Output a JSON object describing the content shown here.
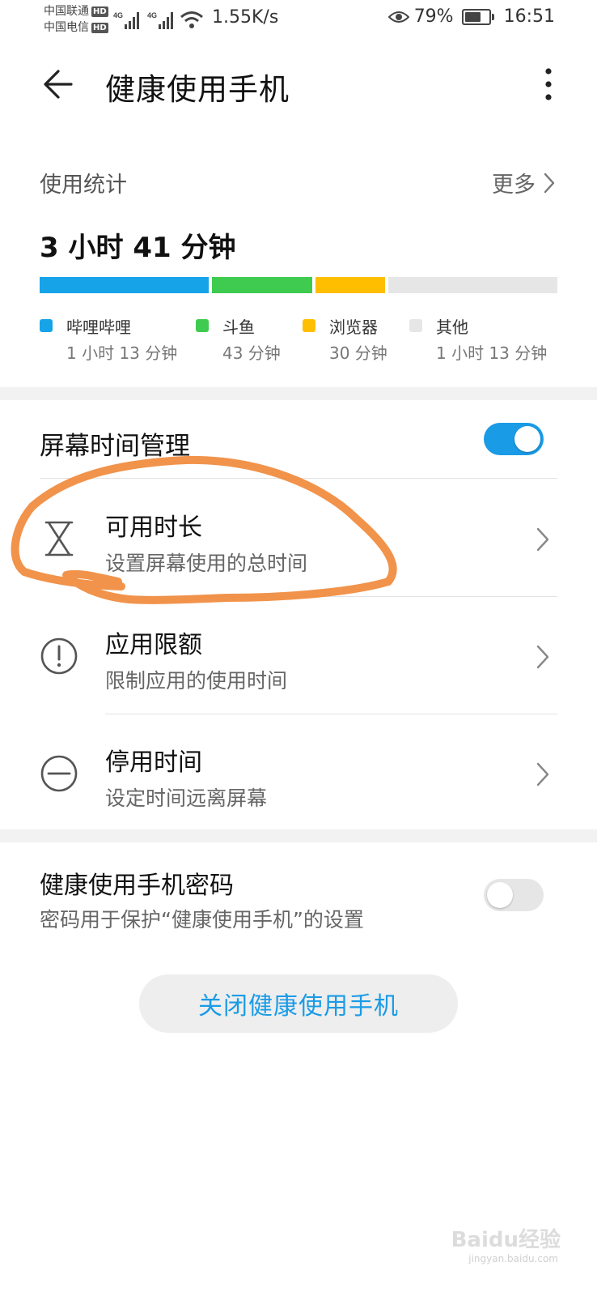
{
  "status_bar": {
    "carrier1": "中国联通",
    "carrier2": "中国电信",
    "hd": "HD",
    "net": "4G",
    "speed": "1.55K/s",
    "battery_text": "79%",
    "battery_level": 0.79,
    "time": "16:51"
  },
  "app_bar": {
    "title": "健康使用手机",
    "back_icon": "arrow-left-icon",
    "more_icon": "more-vert-icon"
  },
  "usage": {
    "label": "使用统计",
    "more": "更多",
    "total": "3 小时 41 分钟",
    "apps": [
      {
        "name": "哔哩哔哩",
        "duration": "1 小时 13 分钟",
        "color": "#16a3e8",
        "minutes": 73
      },
      {
        "name": "斗鱼",
        "duration": "43 分钟",
        "color": "#3fcb4f",
        "minutes": 43
      },
      {
        "name": "浏览器",
        "duration": "30 分钟",
        "color": "#ffbe00",
        "minutes": 30
      },
      {
        "name": "其他",
        "duration": "1 小时 13 分钟",
        "color": "#e6e6e6",
        "minutes": 73
      }
    ]
  },
  "screen_time": {
    "title": "屏幕时间管理",
    "toggle_on": true,
    "items": [
      {
        "title": "可用时长",
        "subtitle": "设置屏幕使用的总时间",
        "icon": "hourglass-icon"
      },
      {
        "title": "应用限额",
        "subtitle": "限制应用的使用时间",
        "icon": "exclamation-circle-icon"
      },
      {
        "title": "停用时间",
        "subtitle": "设定时间远离屏幕",
        "icon": "minus-circle-icon"
      }
    ]
  },
  "password": {
    "title": "健康使用手机密码",
    "subtitle": "密码用于保护“健康使用手机”的设置",
    "toggle_on": false
  },
  "close_button": "关闭健康使用手机",
  "watermark": {
    "brand": "Baidu经验",
    "site": "jingyan.baidu.com"
  },
  "colors": {
    "accent": "#1a9be6",
    "annotation": "#f08a3c"
  }
}
